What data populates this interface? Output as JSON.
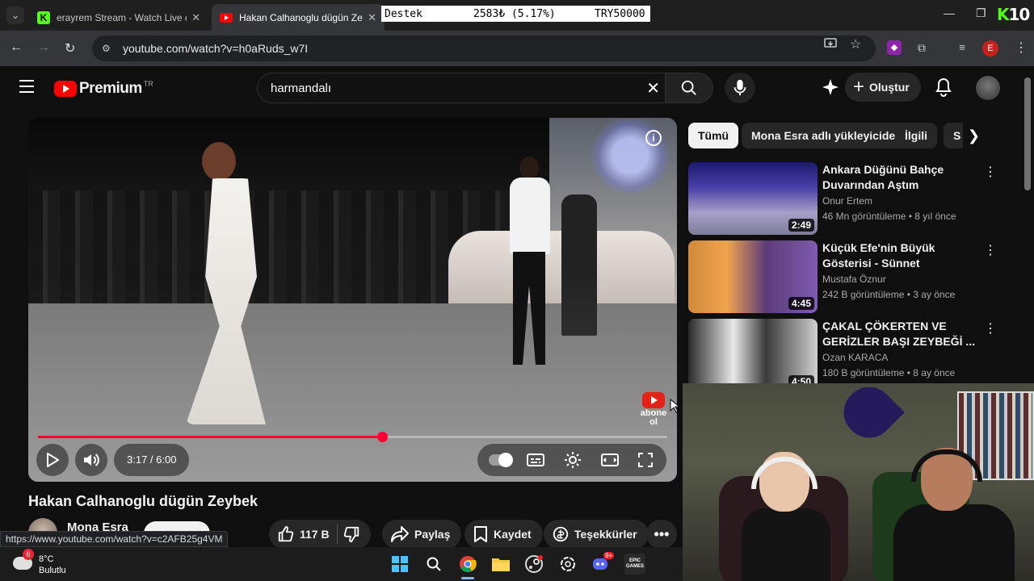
{
  "browser": {
    "tabs": [
      {
        "title": "erayrem Stream - Watch Live o",
        "favicon": "kick-icon"
      },
      {
        "title": "Hakan Calhanoglu dügün Zeyb",
        "favicon": "youtube-icon"
      }
    ],
    "url": "youtube.com/watch?v=h0aRuds_w7I",
    "profile_initial": "E",
    "status_url": "https://www.youtube.com/watch?v=c2AFB25g4VM"
  },
  "donation_bar": {
    "label": "Destek",
    "amount": "2583₺ (5.17%)",
    "goal": "TRY50000"
  },
  "kick_overlay": {
    "letter": "K",
    "number": "10"
  },
  "youtube": {
    "logo_text": "Premium",
    "country": "TR",
    "search_value": "harmandalı",
    "create_label": "Oluştur"
  },
  "player": {
    "time": "3:17 / 6:00",
    "progress_fraction": 0.5472,
    "abone_label": "abone ol",
    "info_glyph": "i"
  },
  "video": {
    "title": "Hakan Calhanoglu dügün Zeybek",
    "channel": "Mona Esra",
    "actions": {
      "likes": "117 B",
      "share": "Paylaş",
      "save": "Kaydet",
      "thanks": "Teşekkürler"
    }
  },
  "sidebar": {
    "chips": [
      "Tümü",
      "Mona Esra adlı yükleyiciden",
      "İlgili",
      "S"
    ],
    "recommendations": [
      {
        "title": "Ankara Düğünü  Bahçe Duvarından Aştım",
        "channel": "Onur Ertem",
        "meta": "46 Mn görüntüleme • 8 yıl önce",
        "duration": "2:49"
      },
      {
        "title": "Küçük Efe'nin Büyük Gösterisi - Sünnet Çocuğundan Unutulma...",
        "channel": "Mustafa Öznur",
        "meta": "242 B görüntüleme • 3 ay önce",
        "duration": "4:45"
      },
      {
        "title": "ÇAKAL ÇÖKERTEN VE GERİZLER BAŞI ZEYBEĞİ ...",
        "channel": "Ozan KARACA",
        "meta": "180 B görüntüleme • 8 ay önce",
        "duration": "4:50"
      }
    ]
  },
  "taskbar": {
    "weather_temp": "8°C",
    "weather_desc": "Bulutlu",
    "weather_badge": "6",
    "discord_badge": "9+",
    "epic_label": "EPIC GAMES"
  },
  "colors": {
    "youtube_red": "#ff0000",
    "progress_red": "#ff0033",
    "kick_green": "#53fc18"
  }
}
